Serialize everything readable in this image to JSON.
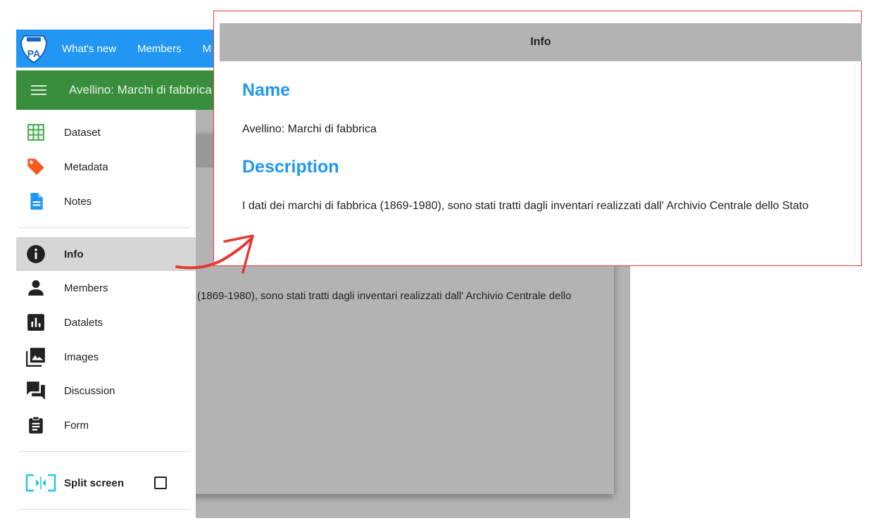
{
  "topbar": {
    "logo_alt": "ROUTE TO PA",
    "nav": [
      "What's new",
      "Members",
      "M"
    ]
  },
  "header": {
    "title": "Avellino: Marchi di fabbrica"
  },
  "background": {
    "description_fragment": "(1869-1980), sono stati tratti dagli inventari realizzati dall' Archivio Centrale dello"
  },
  "sidebar": {
    "items": [
      {
        "label": "Dataset",
        "icon": "grid-icon",
        "color": "#4caf50"
      },
      {
        "label": "Metadata",
        "icon": "tag-icon",
        "color": "#ff5722"
      },
      {
        "label": "Notes",
        "icon": "document-icon",
        "color": "#2196f3"
      },
      {
        "label": "Info",
        "icon": "info-icon",
        "color": "#212121",
        "active": true
      },
      {
        "label": "Members",
        "icon": "person-icon",
        "color": "#212121"
      },
      {
        "label": "Datalets",
        "icon": "bar-chart-icon",
        "color": "#212121"
      },
      {
        "label": "Images",
        "icon": "images-icon",
        "color": "#212121"
      },
      {
        "label": "Discussion",
        "icon": "forum-icon",
        "color": "#212121"
      },
      {
        "label": "Form",
        "icon": "clipboard-icon",
        "color": "#212121"
      }
    ],
    "split_screen": {
      "label": "Split screen",
      "checked": false,
      "icon_color": "#26c6da"
    }
  },
  "popup": {
    "title": "Info",
    "name_heading": "Name",
    "name_value": "Avellino: Marchi di fabbrica",
    "description_heading": "Description",
    "description_value": "I dati dei marchi di fabbrica (1869-1980), sono stati tratti dagli inventari realizzati dall' Archivio Centrale dello Stato"
  },
  "colors": {
    "topbar": "#2196f3",
    "header": "#388e3c",
    "accent": "#2196f3",
    "popup_border": "#e53935",
    "arrow": "#e53935"
  }
}
